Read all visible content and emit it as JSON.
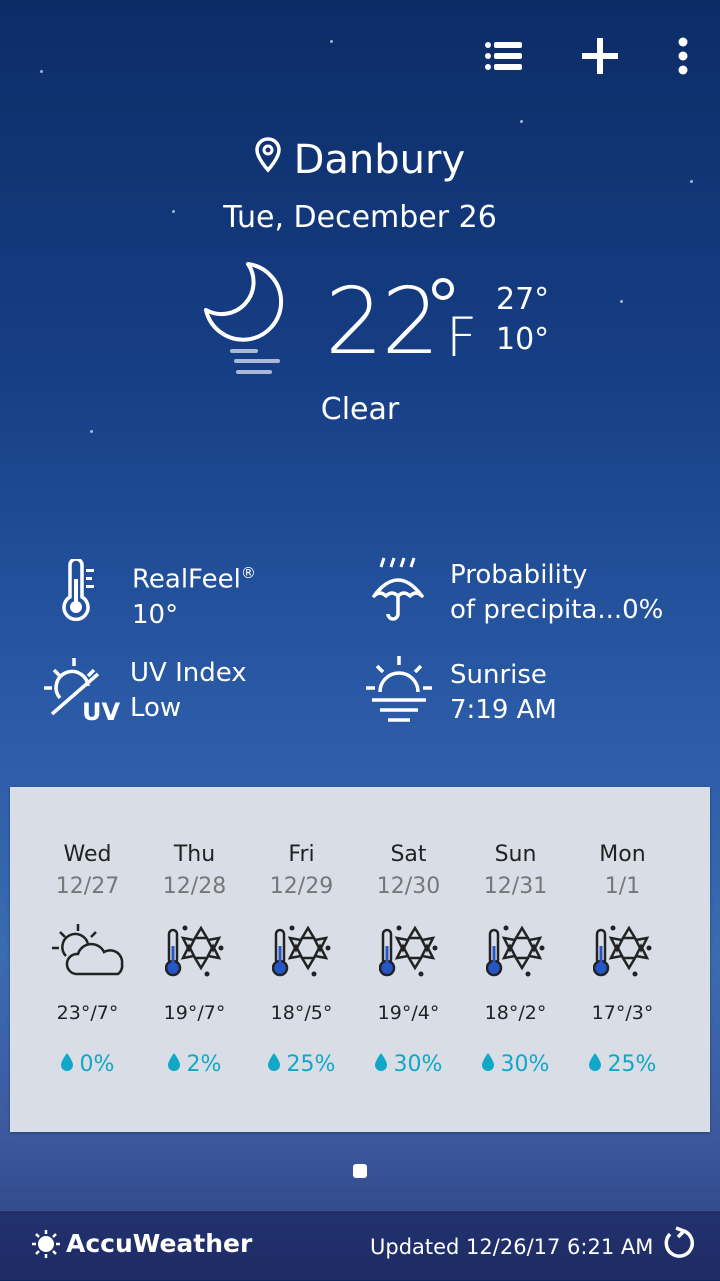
{
  "header": {
    "list_icon": "list-icon",
    "add_icon": "plus-icon",
    "more_icon": "more-vertical-icon"
  },
  "current": {
    "city": "Danbury",
    "date": "Tue, December 26",
    "temp": "22",
    "unit": "F",
    "high": "27°",
    "low": "10°",
    "condition": "Clear"
  },
  "details": {
    "realfeel_label": "RealFeel",
    "realfeel_mark": "®",
    "realfeel_value": "10°",
    "precip_label": "Probability",
    "precip_label2": "of precipita...",
    "precip_value": "0%",
    "uv_label": "UV Index",
    "uv_value": "Low",
    "uv_badge": "UV",
    "sunrise_label": "Sunrise",
    "sunrise_value": "7:19 AM"
  },
  "forecast": [
    {
      "day": "Wed",
      "date": "12/27",
      "temps": "23°/7°",
      "precip": "0%",
      "icon": "partly-cloudy-icon"
    },
    {
      "day": "Thu",
      "date": "12/28",
      "temps": "19°/7°",
      "precip": "2%",
      "icon": "cold-snow-icon"
    },
    {
      "day": "Fri",
      "date": "12/29",
      "temps": "18°/5°",
      "precip": "25%",
      "icon": "cold-snow-icon"
    },
    {
      "day": "Sat",
      "date": "12/30",
      "temps": "19°/4°",
      "precip": "30%",
      "icon": "cold-snow-icon"
    },
    {
      "day": "Sun",
      "date": "12/31",
      "temps": "18°/2°",
      "precip": "30%",
      "icon": "cold-snow-icon"
    },
    {
      "day": "Mon",
      "date": "1/1",
      "temps": "17°/3°",
      "precip": "25%",
      "icon": "cold-snow-icon"
    }
  ],
  "footer": {
    "brand": "AccuWeather",
    "updated": "Updated 12/26/17 6:21 AM"
  },
  "colors": {
    "precip": "#11a8c8",
    "panel": "#d8dde6"
  }
}
